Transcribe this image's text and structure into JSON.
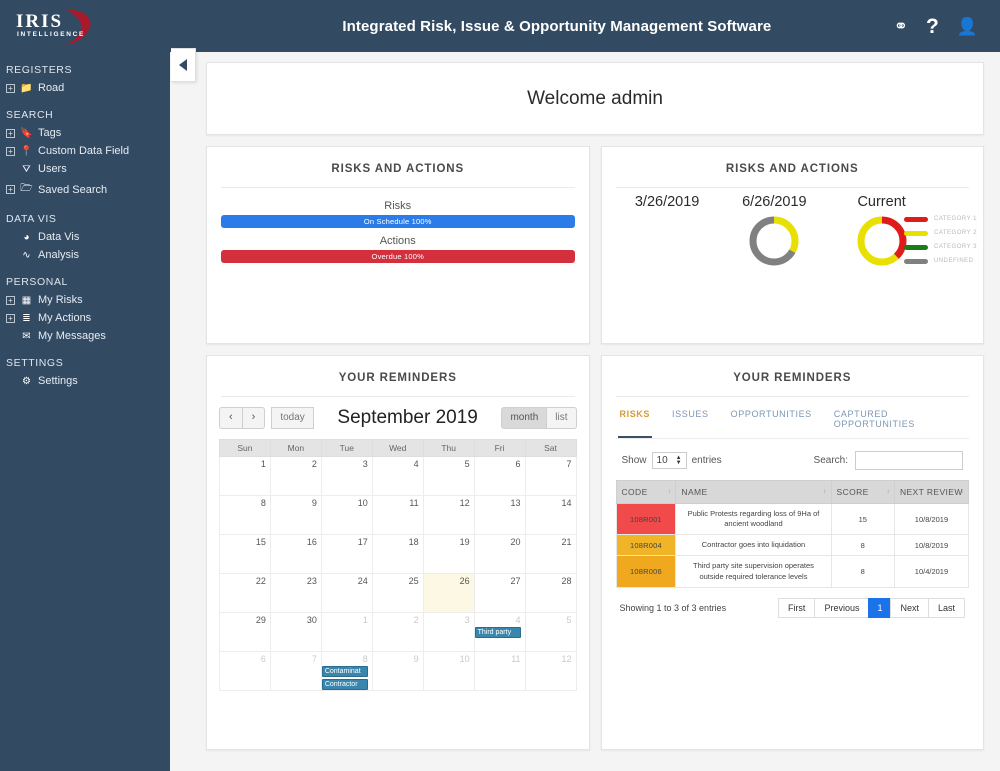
{
  "brand": {
    "name": "IRIS",
    "tagline": "INTELLIGENCE"
  },
  "topbar": {
    "title": "Integrated Risk, Issue & Opportunity Management Software",
    "icons": [
      {
        "name": "link-icon",
        "glyph": "⚭"
      },
      {
        "name": "help-icon",
        "glyph": "?"
      },
      {
        "name": "user-icon",
        "glyph": "👤"
      }
    ]
  },
  "sidebar": {
    "collapse_glyph": "◀",
    "sections": [
      {
        "title": "REGISTERS",
        "items": [
          {
            "label": "Road",
            "icon": "folder-icon",
            "glyph": "📁",
            "expandable": true
          }
        ]
      },
      {
        "title": "SEARCH",
        "items": [
          {
            "label": "Tags",
            "icon": "tag-icon",
            "glyph": "🔖",
            "expandable": true
          },
          {
            "label": "Custom Data Field",
            "icon": "pin-icon",
            "glyph": "📍",
            "expandable": true
          },
          {
            "label": "Users",
            "icon": "users-icon",
            "glyph": "⛛",
            "expandable": false
          },
          {
            "label": "Saved Search",
            "icon": "folder-open-icon",
            "glyph": "🗁",
            "expandable": true
          }
        ]
      },
      {
        "title": "DATA VIS",
        "items": [
          {
            "label": "Data Vis",
            "icon": "pie-chart-icon",
            "glyph": "◕",
            "expandable": false
          },
          {
            "label": "Analysis",
            "icon": "line-chart-icon",
            "glyph": "∿",
            "expandable": false
          }
        ]
      },
      {
        "title": "PERSONAL",
        "items": [
          {
            "label": "My Risks",
            "icon": "grid-icon",
            "glyph": "▦",
            "expandable": true
          },
          {
            "label": "My Actions",
            "icon": "list-icon",
            "glyph": "≣",
            "expandable": true
          },
          {
            "label": "My Messages",
            "icon": "envelope-icon",
            "glyph": "✉",
            "expandable": false
          }
        ]
      },
      {
        "title": "SETTINGS",
        "items": [
          {
            "label": "Settings",
            "icon": "gear-icon",
            "glyph": "⚙",
            "expandable": false
          }
        ]
      }
    ]
  },
  "welcome": {
    "text": "Welcome admin"
  },
  "bars_card": {
    "title": "RISKS AND ACTIONS",
    "chart_data": {
      "type": "bar",
      "title": "RISKS AND ACTIONS",
      "categories": [
        "Risks",
        "Actions"
      ],
      "series": [
        {
          "name": "On Schedule",
          "label": "On Schedule 100%",
          "category": "Risks",
          "value": 100,
          "color": "#2b7ce9"
        },
        {
          "name": "Overdue",
          "label": "Overdue 100%",
          "category": "Actions",
          "value": 100,
          "color": "#d32f3d"
        }
      ],
      "xlabel": "",
      "ylabel": "",
      "ylim": [
        0,
        100
      ]
    }
  },
  "donut_card": {
    "title": "RISKS AND ACTIONS",
    "chart_data": {
      "type": "pie",
      "title": "RISKS AND ACTIONS",
      "period_labels": [
        "3/26/2019",
        "6/26/2019",
        "Current"
      ],
      "legend_position": "right",
      "legend": [
        {
          "label": "CATEGORY 1",
          "color": "#e01b1b"
        },
        {
          "label": "CATEGORY 2",
          "color": "#e8e000"
        },
        {
          "label": "CATEGORY 3",
          "color": "#1a7d1a"
        },
        {
          "label": "UNDEFINED",
          "color": "#808080"
        }
      ],
      "charts": [
        {
          "period": "3/26/2019",
          "empty": true,
          "slices": []
        },
        {
          "period": "6/26/2019",
          "empty": false,
          "slices": [
            {
              "label": "CATEGORY 2",
              "value": 33,
              "color": "#e8e000"
            },
            {
              "label": "UNDEFINED",
              "value": 67,
              "color": "#808080"
            }
          ]
        },
        {
          "period": "Current",
          "empty": false,
          "slices": [
            {
              "label": "CATEGORY 1",
              "value": 38,
              "color": "#e01b1b"
            },
            {
              "label": "CATEGORY 2",
              "value": 62,
              "color": "#e8e000"
            }
          ]
        }
      ]
    }
  },
  "calendar_card": {
    "title": "YOUR REMINDERS",
    "toolbar": {
      "prev": "‹",
      "next": "›",
      "today": "today",
      "title": "September 2019",
      "views": [
        {
          "label": "month",
          "active": true
        },
        {
          "label": "list",
          "active": false
        }
      ]
    },
    "weekdays": [
      "Sun",
      "Mon",
      "Tue",
      "Wed",
      "Thu",
      "Fri",
      "Sat"
    ],
    "weeks": [
      [
        {
          "d": "1"
        },
        {
          "d": "2"
        },
        {
          "d": "3"
        },
        {
          "d": "4"
        },
        {
          "d": "5"
        },
        {
          "d": "6"
        },
        {
          "d": "7"
        }
      ],
      [
        {
          "d": "8"
        },
        {
          "d": "9"
        },
        {
          "d": "10"
        },
        {
          "d": "11"
        },
        {
          "d": "12"
        },
        {
          "d": "13"
        },
        {
          "d": "14"
        }
      ],
      [
        {
          "d": "15"
        },
        {
          "d": "16"
        },
        {
          "d": "17"
        },
        {
          "d": "18"
        },
        {
          "d": "19"
        },
        {
          "d": "20"
        },
        {
          "d": "21"
        }
      ],
      [
        {
          "d": "22"
        },
        {
          "d": "23"
        },
        {
          "d": "24"
        },
        {
          "d": "25"
        },
        {
          "d": "26",
          "today": true
        },
        {
          "d": "27"
        },
        {
          "d": "28"
        }
      ],
      [
        {
          "d": "29"
        },
        {
          "d": "30"
        },
        {
          "d": "1",
          "other": true
        },
        {
          "d": "2",
          "other": true
        },
        {
          "d": "3",
          "other": true
        },
        {
          "d": "4",
          "other": true,
          "events": [
            "Third party"
          ]
        },
        {
          "d": "5",
          "other": true
        }
      ],
      [
        {
          "d": "6",
          "other": true
        },
        {
          "d": "7",
          "other": true
        },
        {
          "d": "8",
          "other": true,
          "events": [
            "Contaminat",
            "Contractor "
          ]
        },
        {
          "d": "9",
          "other": true
        },
        {
          "d": "10",
          "other": true
        },
        {
          "d": "11",
          "other": true
        },
        {
          "d": "12",
          "other": true
        }
      ]
    ]
  },
  "reminders_card": {
    "title": "YOUR REMINDERS",
    "tabs": [
      {
        "label": "RISKS",
        "active": true
      },
      {
        "label": "ISSUES",
        "active": false
      },
      {
        "label": "OPPORTUNITIES",
        "active": false
      },
      {
        "label": "CAPTURED OPPORTUNITIES",
        "active": false
      }
    ],
    "show_prefix": "Show",
    "show_value": "10",
    "show_suffix": "entries",
    "search_label": "Search:",
    "search_value": "",
    "search_placeholder": "",
    "columns": [
      "CODE",
      "NAME",
      "SCORE",
      "NEXT REVIEW"
    ],
    "rows": [
      {
        "code": "108R001",
        "code_color": "#f04a4a",
        "name": "Public Protests regarding loss of 9Ha of ancient woodland",
        "score": "15",
        "next_review": "10/8/2019"
      },
      {
        "code": "108R004",
        "code_color": "#f0b429",
        "name": "Contractor goes into liquidation",
        "score": "8",
        "next_review": "10/8/2019"
      },
      {
        "code": "108R006",
        "code_color": "#f0a81e",
        "name": "Third party site supervision operates outside required tolerance levels",
        "score": "8",
        "next_review": "10/4/2019"
      }
    ],
    "footer_info": "Showing 1 to 3 of 3 entries",
    "pager": [
      {
        "label": "First",
        "current": false
      },
      {
        "label": "Previous",
        "current": false
      },
      {
        "label": "1",
        "current": true
      },
      {
        "label": "Next",
        "current": false
      },
      {
        "label": "Last",
        "current": false
      }
    ]
  },
  "colors": {
    "sidebar_bg": "#334a63",
    "accent_blue": "#2b7ce9",
    "accent_red": "#d32f3d",
    "tab_active": "#d79a2b",
    "pager_active": "#1a73e8"
  }
}
